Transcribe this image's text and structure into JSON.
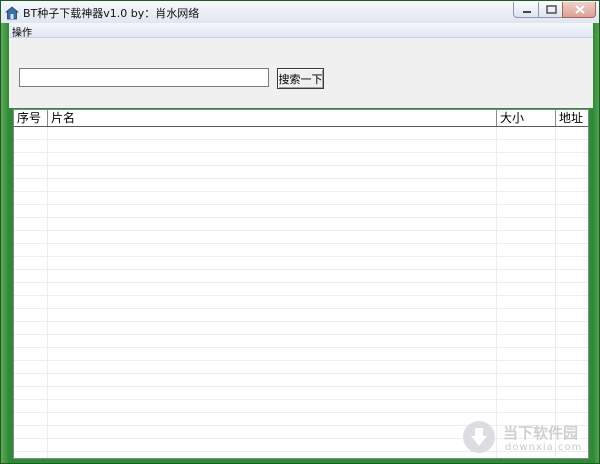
{
  "window": {
    "title": "BT种子下载神器v1.0  by：肖水网络",
    "app_icon": "house-icon"
  },
  "menu": {
    "items": [
      "操作"
    ]
  },
  "search": {
    "value": "",
    "button_label": "搜索一下"
  },
  "table": {
    "columns": [
      "序号",
      "片名",
      "大小",
      "地址"
    ],
    "rows": []
  },
  "watermark": {
    "name": "当下软件园",
    "url": "downxia.com"
  },
  "colors": {
    "frame": "#2f8a35",
    "client": "#f0f0f0"
  }
}
